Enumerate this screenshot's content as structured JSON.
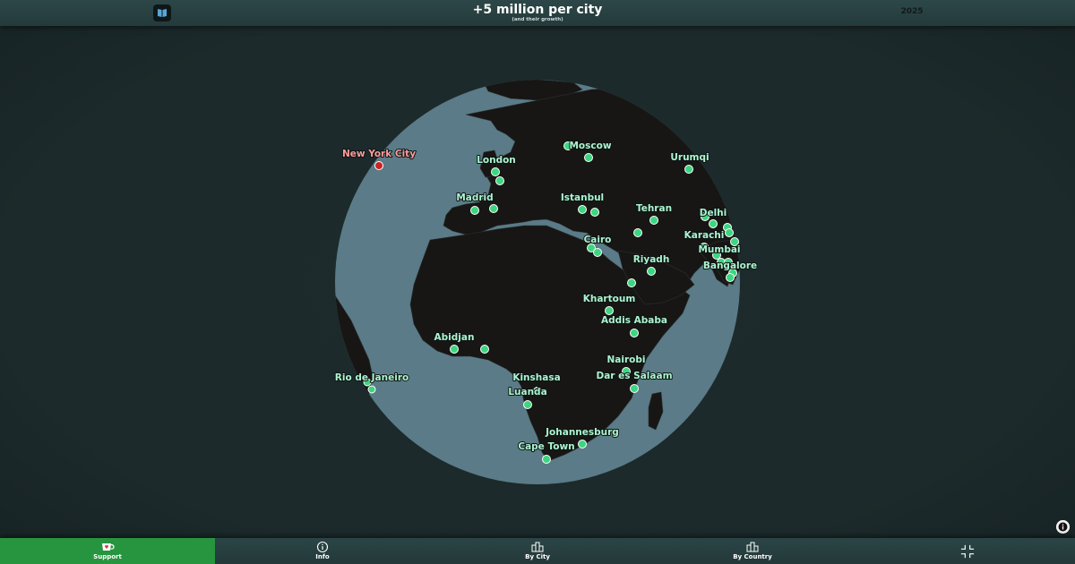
{
  "header": {
    "title": "+5 million per city",
    "subtitle": "(and their growth)",
    "year": "2025",
    "book_icon": "book-icon"
  },
  "map": {
    "ocean_color": "#5a7b87",
    "land_color": "#171614",
    "marker_color": "#3dd680",
    "highlight_color": "#cc2222",
    "cities": [
      {
        "id": "new-york-city",
        "name": "New York City",
        "highlight": true
      },
      {
        "id": "london",
        "name": "London"
      },
      {
        "id": "moscow",
        "name": "Moscow"
      },
      {
        "id": "urumqi",
        "name": "Urumqi"
      },
      {
        "id": "madrid",
        "name": "Madrid"
      },
      {
        "id": "istanbul",
        "name": "Istanbul"
      },
      {
        "id": "tehran",
        "name": "Tehran"
      },
      {
        "id": "delhi",
        "name": "Delhi"
      },
      {
        "id": "karachi",
        "name": "Karachi"
      },
      {
        "id": "cairo",
        "name": "Cairo"
      },
      {
        "id": "mumbai",
        "name": "Mumbai"
      },
      {
        "id": "riyadh",
        "name": "Riyadh"
      },
      {
        "id": "bangalore",
        "name": "Bangalore"
      },
      {
        "id": "khartoum",
        "name": "Khartoum"
      },
      {
        "id": "addis-ababa",
        "name": "Addis Ababa"
      },
      {
        "id": "abidjan",
        "name": "Abidjan"
      },
      {
        "id": "nairobi",
        "name": "Nairobi"
      },
      {
        "id": "rio-de-janeiro",
        "name": "Rio de Janeiro"
      },
      {
        "id": "kinshasa",
        "name": "Kinshasa"
      },
      {
        "id": "dar-es-salaam",
        "name": "Dar es Salaam"
      },
      {
        "id": "luanda",
        "name": "Luanda"
      },
      {
        "id": "johannesburg",
        "name": "Johannesburg"
      },
      {
        "id": "cape-town",
        "name": "Cape Town"
      }
    ]
  },
  "footer": {
    "tabs": [
      {
        "label": "Support",
        "icon": "heart-cup-icon",
        "active": true
      },
      {
        "label": "Info",
        "icon": "info-circle-icon"
      },
      {
        "label": "By City",
        "icon": "buildings-icon"
      },
      {
        "label": "By Country",
        "icon": "buildings-icon"
      },
      {
        "label": "",
        "icon": "collapse-icon"
      }
    ],
    "info_button_icon": "info-icon"
  }
}
